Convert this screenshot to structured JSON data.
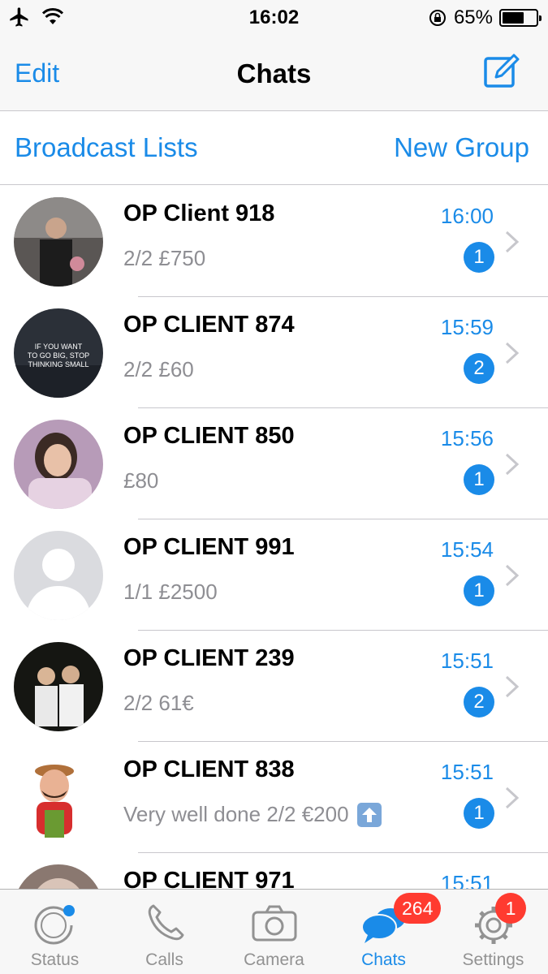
{
  "status_bar": {
    "time": "16:02",
    "battery_percent": "65%",
    "battery_level": 0.65,
    "icons": [
      "airplane-icon",
      "wifi-icon",
      "rotation-lock-icon",
      "battery-icon"
    ]
  },
  "nav": {
    "edit_label": "Edit",
    "title": "Chats",
    "compose_icon": "compose-icon"
  },
  "lists": {
    "broadcast_label": "Broadcast Lists",
    "new_group_label": "New Group"
  },
  "chats": [
    {
      "name": "OP Client 918",
      "time": "16:00",
      "preview": "2/2 £750",
      "unread": "1"
    },
    {
      "name": "OP CLIENT 874",
      "time": "15:59",
      "preview": "2/2 £60",
      "unread": "2",
      "avatar_text": [
        "IF YOU WANT",
        "TO GO BIG, STOP",
        "THINKING SMALL"
      ]
    },
    {
      "name": "OP CLIENT 850",
      "time": "15:56",
      "preview": "£80",
      "unread": "1"
    },
    {
      "name": "OP CLIENT 991",
      "time": "15:54",
      "preview": "1/1 £2500",
      "unread": "1"
    },
    {
      "name": "OP CLIENT 239",
      "time": "15:51",
      "preview": "2/2 61€",
      "unread": "2"
    },
    {
      "name": "OP CLIENT 838",
      "time": "15:51",
      "preview": "Very well done 2/2 €200",
      "unread": "1"
    },
    {
      "name": "OP CLIENT 971",
      "time": "15:51",
      "preview": "",
      "unread": ""
    }
  ],
  "tabs": {
    "status": {
      "label": "Status"
    },
    "calls": {
      "label": "Calls"
    },
    "camera": {
      "label": "Camera"
    },
    "chats": {
      "label": "Chats",
      "badge": "264"
    },
    "settings": {
      "label": "Settings",
      "badge": "1"
    }
  },
  "colors": {
    "accent": "#1a8be8",
    "badge_red": "#ff3b30",
    "secondary_text": "#8e8e93",
    "bar_background": "#f7f7f7"
  }
}
